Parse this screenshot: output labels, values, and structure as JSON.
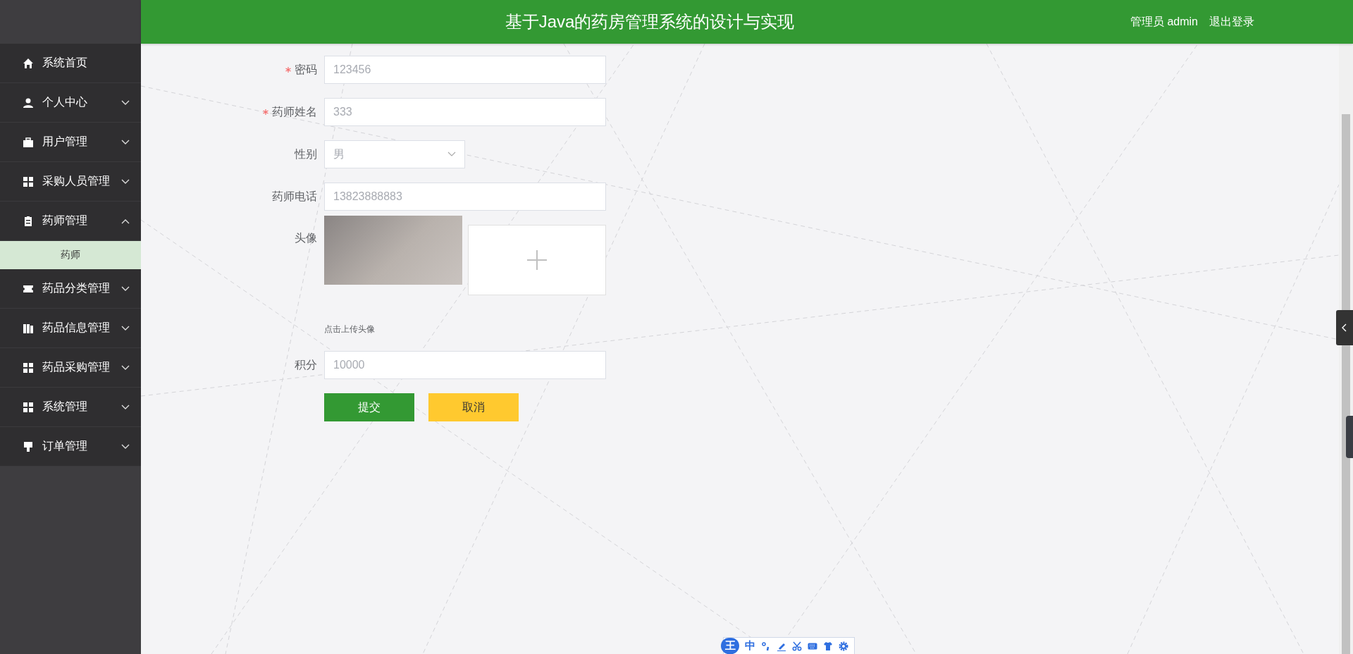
{
  "header": {
    "title": "基于Java的药房管理系统的设计与实现",
    "user_label": "管理员 admin",
    "logout": "退出登录"
  },
  "sidebar": {
    "items": [
      {
        "kind": "link",
        "label": "系统首页"
      },
      {
        "kind": "submenu",
        "label": "个人中心",
        "expanded": false
      },
      {
        "kind": "submenu",
        "label": "用户管理",
        "expanded": false
      },
      {
        "kind": "submenu",
        "label": "采购人员管理",
        "expanded": false
      },
      {
        "kind": "submenu",
        "label": "药师管理",
        "expanded": true,
        "children": [
          {
            "label": "药师",
            "selected": true
          }
        ]
      },
      {
        "kind": "submenu",
        "label": "药品分类管理",
        "expanded": false
      },
      {
        "kind": "submenu",
        "label": "药品信息管理",
        "expanded": false
      },
      {
        "kind": "submenu",
        "label": "药品采购管理",
        "expanded": false
      },
      {
        "kind": "submenu",
        "label": "系统管理",
        "expanded": false
      },
      {
        "kind": "submenu",
        "label": "订单管理",
        "expanded": false
      }
    ]
  },
  "form": {
    "fields": [
      {
        "kind": "text",
        "label": "密码",
        "required": true,
        "value": "123456"
      },
      {
        "kind": "text",
        "label": "药师姓名",
        "required": true,
        "value": "333"
      },
      {
        "kind": "select",
        "label": "性别",
        "required": false,
        "value": "男"
      },
      {
        "kind": "text",
        "label": "药师电话",
        "required": false,
        "value": "13823888883"
      },
      {
        "kind": "image",
        "label": "头像",
        "required": false,
        "hint": "点击上传头像"
      },
      {
        "kind": "text",
        "label": "积分",
        "required": false,
        "value": "10000"
      }
    ],
    "buttons": [
      {
        "kind": "primary",
        "label": "提交"
      },
      {
        "kind": "cancel",
        "label": "取消"
      }
    ]
  },
  "ime_toolbar": {
    "logo": "王",
    "mode": "中"
  }
}
